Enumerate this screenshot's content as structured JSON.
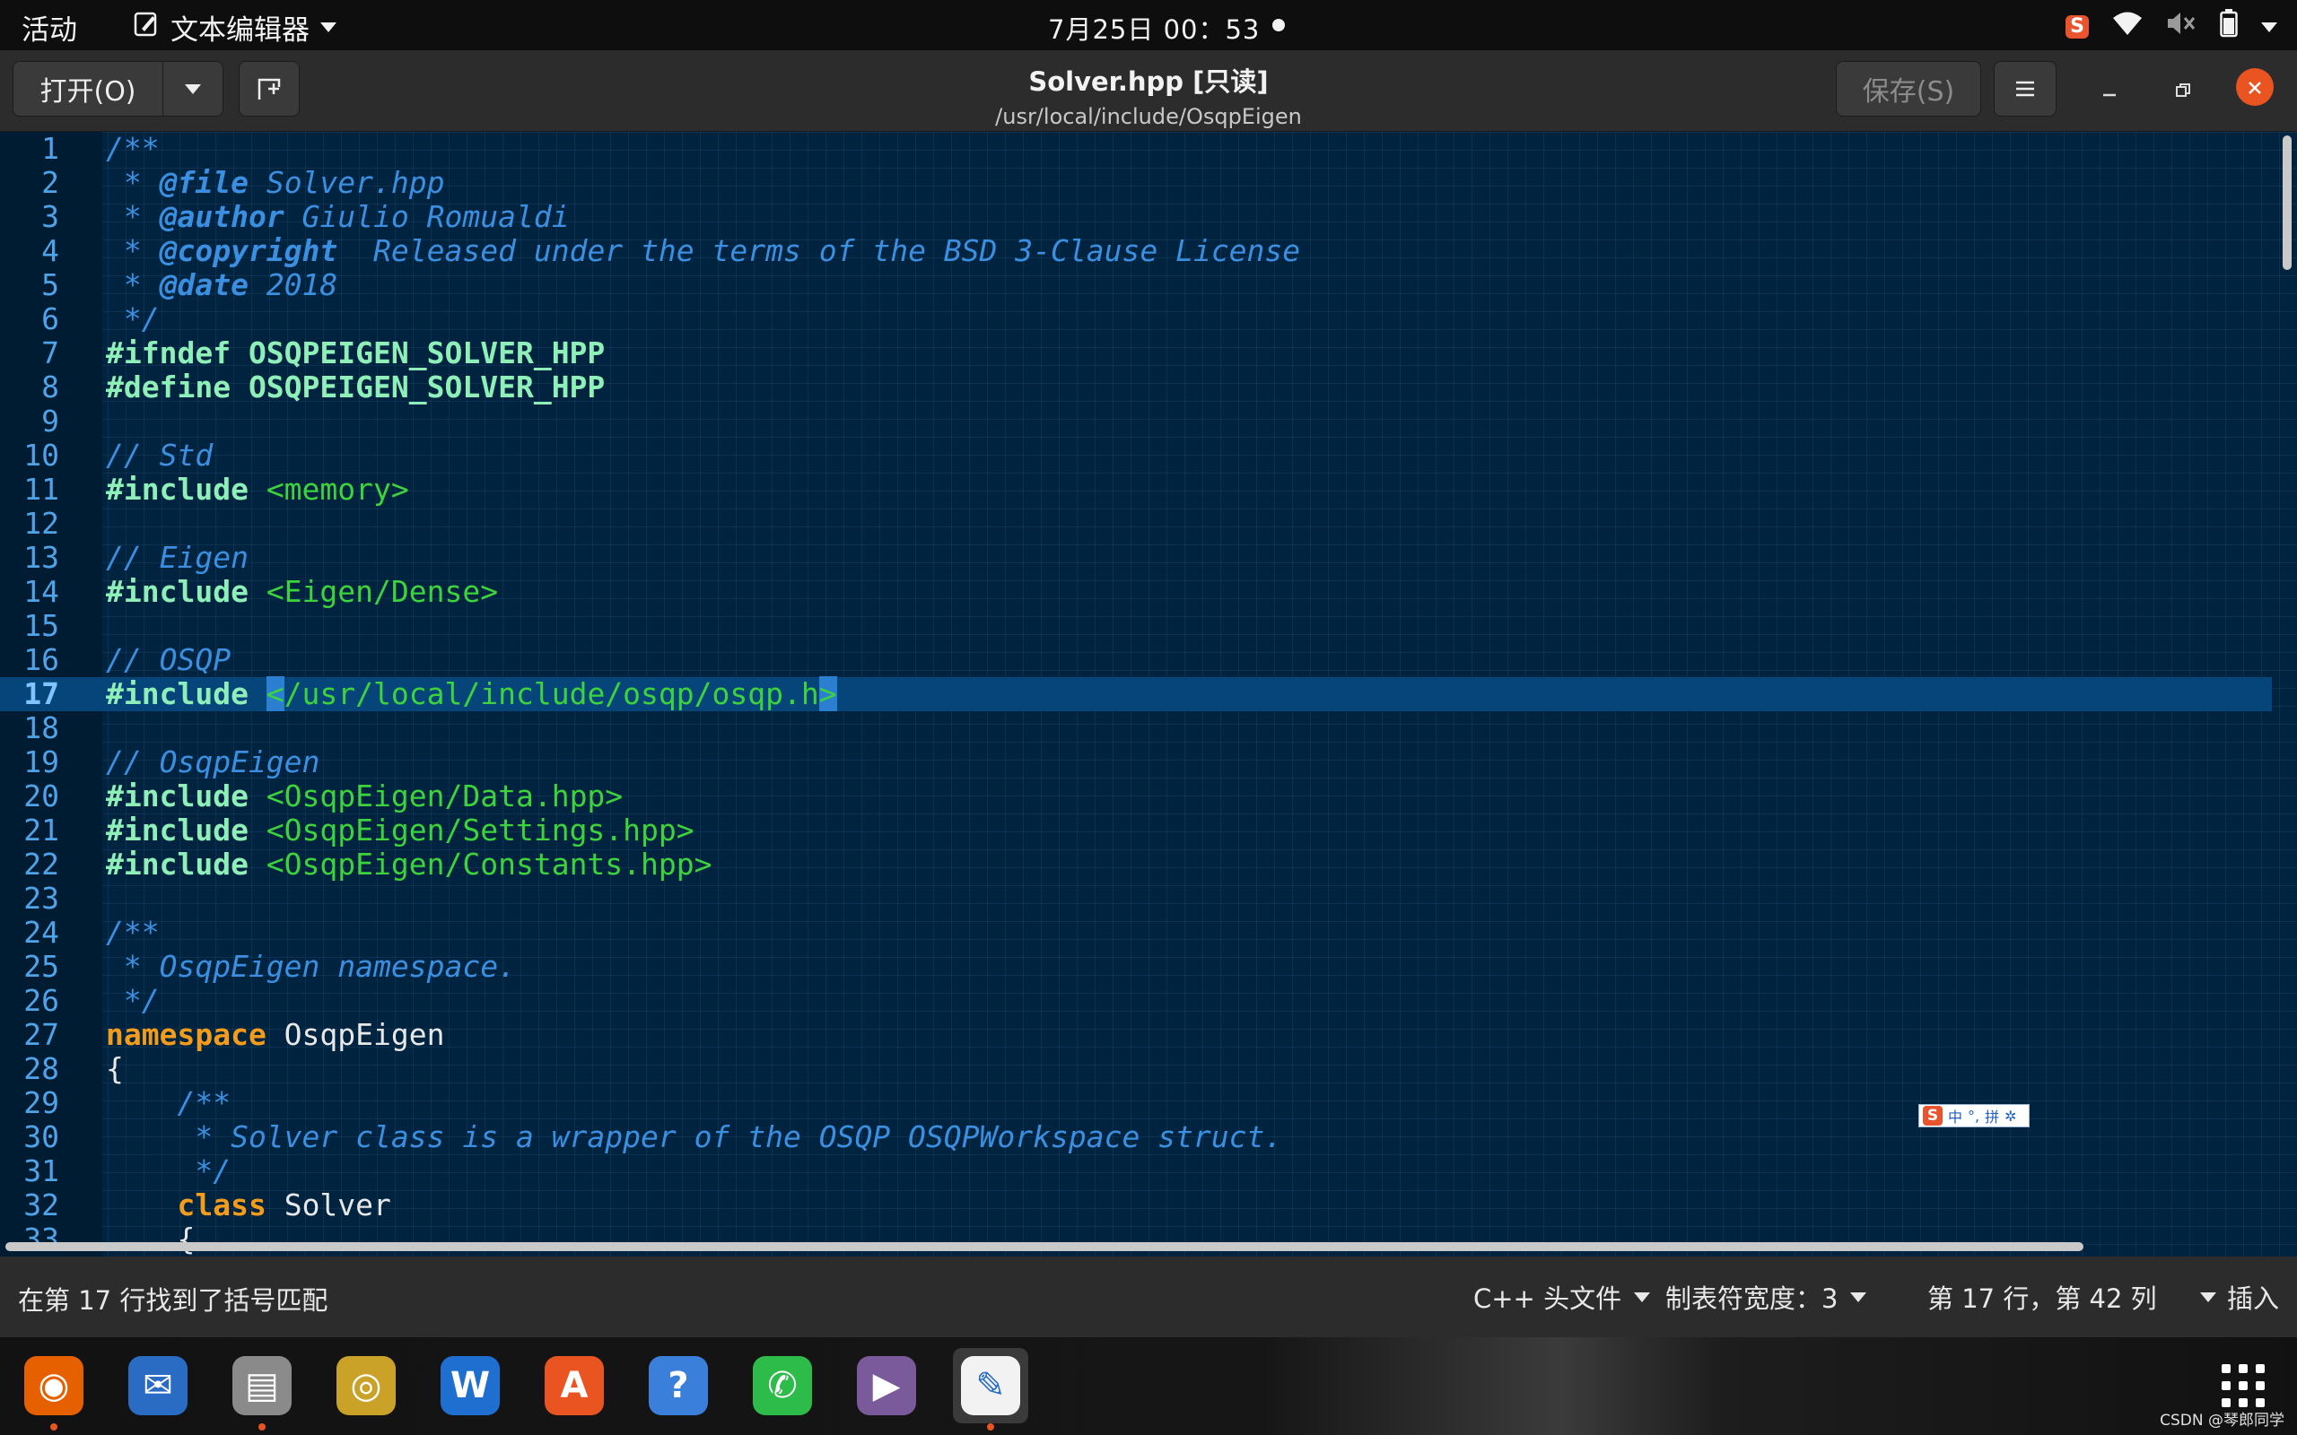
{
  "topbar": {
    "activities": "活动",
    "app_name": "文本编辑器",
    "clock": "7月25日  00：53"
  },
  "header": {
    "open_label": "打开(O)",
    "title": "Solver.hpp [只读]",
    "subtitle": "/usr/local/include/OsqpEigen",
    "save_label": "保存(S)"
  },
  "editor": {
    "current_line": 17,
    "lines": [
      [
        [
          "cm",
          "/**"
        ]
      ],
      [
        [
          "cm",
          " * "
        ],
        [
          "tag",
          "@file"
        ],
        [
          "cm",
          " Solver.hpp"
        ]
      ],
      [
        [
          "cm",
          " * "
        ],
        [
          "tag",
          "@author"
        ],
        [
          "cm",
          " Giulio Romualdi"
        ]
      ],
      [
        [
          "cm",
          " * "
        ],
        [
          "tag",
          "@copyright"
        ],
        [
          "cm",
          "  Released under the terms of the BSD 3-Clause License"
        ]
      ],
      [
        [
          "cm",
          " * "
        ],
        [
          "tag",
          "@date"
        ],
        [
          "cm",
          " 2018"
        ]
      ],
      [
        [
          "cm",
          " */"
        ]
      ],
      [
        [
          "pp",
          "#ifndef OSQPEIGEN_SOLVER_HPP"
        ]
      ],
      [
        [
          "pp",
          "#define OSQPEIGEN_SOLVER_HPP"
        ]
      ],
      [],
      [
        [
          "cm",
          "// Std"
        ]
      ],
      [
        [
          "pp",
          "#include "
        ],
        [
          "inc",
          "<memory>"
        ]
      ],
      [],
      [
        [
          "cm",
          "// Eigen"
        ]
      ],
      [
        [
          "pp",
          "#include "
        ],
        [
          "inc",
          "<Eigen/Dense>"
        ]
      ],
      [],
      [
        [
          "cm",
          "// OSQP"
        ]
      ],
      [
        [
          "pp",
          "#include "
        ],
        [
          "bracket",
          "<"
        ],
        [
          "inc",
          "/usr/local/include/osqp/osqp.h"
        ],
        [
          "bracket",
          ">"
        ]
      ],
      [],
      [
        [
          "cm",
          "// OsqpEigen"
        ]
      ],
      [
        [
          "pp",
          "#include "
        ],
        [
          "inc",
          "<OsqpEigen/Data.hpp>"
        ]
      ],
      [
        [
          "pp",
          "#include "
        ],
        [
          "inc",
          "<OsqpEigen/Settings.hpp>"
        ]
      ],
      [
        [
          "pp",
          "#include "
        ],
        [
          "inc",
          "<OsqpEigen/Constants.hpp>"
        ]
      ],
      [],
      [
        [
          "cm",
          "/**"
        ]
      ],
      [
        [
          "cm",
          " * OsqpEigen namespace."
        ]
      ],
      [
        [
          "cm",
          " */"
        ]
      ],
      [
        [
          "kw",
          "namespace"
        ],
        [
          "id",
          " OsqpEigen"
        ]
      ],
      [
        [
          "id",
          "{"
        ]
      ],
      [
        [
          "cm",
          "    /**"
        ]
      ],
      [
        [
          "cm",
          "     * Solver class is a wrapper of the OSQP OSQPWorkspace struct."
        ]
      ],
      [
        [
          "cm",
          "     */"
        ]
      ],
      [
        [
          "id",
          "    "
        ],
        [
          "kw",
          "class"
        ],
        [
          "id",
          " Solver"
        ]
      ],
      [
        [
          "id",
          "    {"
        ]
      ]
    ]
  },
  "ime": {
    "chars": [
      "中",
      "°,",
      "拼",
      "✲"
    ]
  },
  "status": {
    "message": "在第 17 行找到了括号匹配",
    "language": "C++ 头文件",
    "tab_width": "制表符宽度：3",
    "position": "第 17 行，第 42 列",
    "mode": "插入"
  },
  "dock": {
    "apps": [
      {
        "name": "firefox",
        "color": "#e66000",
        "glyph": "◉",
        "running": true
      },
      {
        "name": "thunderbird",
        "color": "#2a6cc4",
        "glyph": "✉",
        "running": false
      },
      {
        "name": "files",
        "color": "#8a8a8a",
        "glyph": "▤",
        "running": true
      },
      {
        "name": "rhythmbox",
        "color": "#c9a227",
        "glyph": "◎",
        "running": false
      },
      {
        "name": "libreoffice-writer",
        "color": "#1f6fd1",
        "glyph": "W",
        "running": false
      },
      {
        "name": "software",
        "color": "#e95420",
        "glyph": "A",
        "running": false
      },
      {
        "name": "help",
        "color": "#3a7fd9",
        "glyph": "?",
        "running": false
      },
      {
        "name": "wechat",
        "color": "#2dbb4a",
        "glyph": "✆",
        "running": false
      },
      {
        "name": "video",
        "color": "#7a5a9a",
        "glyph": "▶",
        "running": false
      },
      {
        "name": "text-editor",
        "color": "#f2f2f2",
        "glyph": "✎",
        "running": true
      }
    ]
  },
  "watermark": "CSDN @琴郎同学"
}
